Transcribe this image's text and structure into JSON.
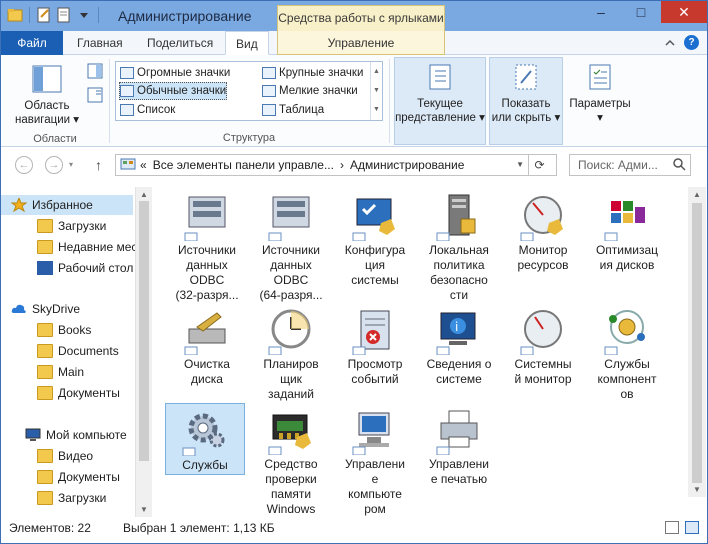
{
  "window": {
    "title": "Администрирование",
    "tools_tab": "Средства работы с ярлыками"
  },
  "ribbon_tabs": {
    "file": "Файл",
    "home": "Главная",
    "share": "Поделиться",
    "view": "Вид",
    "manage": "Управление"
  },
  "ribbon": {
    "nav_pane_label_1": "Область",
    "nav_pane_label_2": "навигации",
    "group_panes": "Области",
    "layout": {
      "huge_icons": "Огромные значки",
      "large_icons": "Крупные значки",
      "medium_icons": "Обычные значки",
      "small_icons": "Мелкие значки",
      "list": "Список",
      "table": "Таблица"
    },
    "group_layout": "Структура",
    "current_view_1": "Текущее",
    "current_view_2": "представление",
    "show_hide_1": "Показать",
    "show_hide_2": "или скрыть",
    "options": "Параметры"
  },
  "address": {
    "chevrons": "«",
    "crumb1": "Все элементы панели управле...",
    "sep": "›",
    "crumb2": "Администрирование",
    "search_placeholder": "Поиск: Адми..."
  },
  "nav": {
    "favorites": "Избранное",
    "downloads": "Загрузки",
    "recent": "Недавние мес",
    "desktop": "Рабочий стол",
    "skydrive": "SkyDrive",
    "books": "Books",
    "documents_sky": "Documents",
    "main": "Main",
    "docs_sky_ru": "Документы",
    "computer": "Мой компьюте",
    "video": "Видео",
    "docs_pc": "Документы",
    "downloads_pc": "Загрузки"
  },
  "items": [
    {
      "l1": "Источники",
      "l2": "данных",
      "l3": "ODBC",
      "l4": "(32-разря..."
    },
    {
      "l1": "Источники",
      "l2": "данных",
      "l3": "ODBC",
      "l4": "(64-разря..."
    },
    {
      "l1": "Конфигура",
      "l2": "ция",
      "l3": "системы",
      "l4": ""
    },
    {
      "l1": "Локальная",
      "l2": "политика",
      "l3": "безопасно",
      "l4": "сти"
    },
    {
      "l1": "Монитор",
      "l2": "ресурсов",
      "l3": "",
      "l4": ""
    },
    {
      "l1": "Оптимизац",
      "l2": "ия дисков",
      "l3": "",
      "l4": ""
    },
    {
      "l1": "Очистка",
      "l2": "диска",
      "l3": "",
      "l4": ""
    },
    {
      "l1": "Планиров",
      "l2": "щик",
      "l3": "заданий",
      "l4": ""
    },
    {
      "l1": "Просмотр",
      "l2": "событий",
      "l3": "",
      "l4": ""
    },
    {
      "l1": "Сведения о",
      "l2": "системе",
      "l3": "",
      "l4": ""
    },
    {
      "l1": "Системны",
      "l2": "й монитор",
      "l3": "",
      "l4": ""
    },
    {
      "l1": "Службы",
      "l2": "компонент",
      "l3": "ов",
      "l4": ""
    },
    {
      "l1": "Службы",
      "l2": "",
      "l3": "",
      "l4": ""
    },
    {
      "l1": "Средство",
      "l2": "проверки",
      "l3": "памяти",
      "l4": "Windows"
    },
    {
      "l1": "Управлени",
      "l2": "е",
      "l3": "компьюте",
      "l4": "ром"
    },
    {
      "l1": "Управлени",
      "l2": "е печатью",
      "l3": "",
      "l4": ""
    }
  ],
  "status": {
    "count": "Элементов: 22",
    "selected": "Выбран 1 элемент: 1,13 КБ"
  }
}
